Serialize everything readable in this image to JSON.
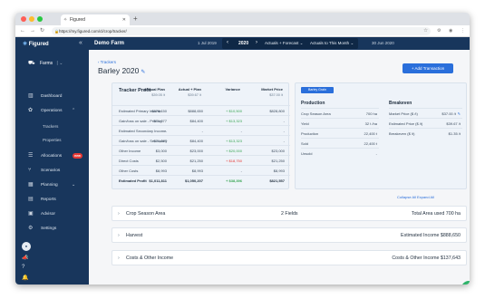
{
  "browser": {
    "tab_title": "Figured",
    "url": "https://my.figured.com/cl/crop/tracker/",
    "colors": {
      "close": "#ff5f57",
      "minimize": "#febc2e",
      "maximize": "#28c840"
    },
    "icons": {
      "back": "arrow-left-icon",
      "forward": "arrow-right-icon",
      "reload": "reload-icon",
      "lock": "lock-icon",
      "star": "star-icon",
      "profile": "profile-icon",
      "menu": "kebab-menu-icon"
    }
  },
  "sidebar": {
    "logo_text": "Figured",
    "farms_label": "Farms",
    "items": [
      {
        "label": "Dashboard",
        "icon": "chart-icon"
      },
      {
        "label": "Operations",
        "icon": "sprout-icon",
        "expanded": true
      },
      {
        "label": "Allocations",
        "icon": "list-icon",
        "badge": "new"
      },
      {
        "label": "Scenarios",
        "icon": "branch-icon"
      },
      {
        "label": "Planning",
        "icon": "grid-icon"
      },
      {
        "label": "Reports",
        "icon": "document-icon"
      },
      {
        "label": "Advisor",
        "icon": "book-icon"
      },
      {
        "label": "Settings",
        "icon": "gear-icon"
      }
    ],
    "sub_items": [
      "Trackers",
      "Properties"
    ],
    "badge_text": "new"
  },
  "topbar": {
    "farm_name": "Demo Farm",
    "date_start": "1 Jul 2019",
    "year": "2020",
    "mode_forecast": "Actuals + Forecast",
    "mode_range": "Actuals to This Month",
    "date_end": "30 Jun 2020"
  },
  "page": {
    "back_link": "Trackers",
    "title": "Barley 2020",
    "add_button": "+ Add Transaction",
    "expand_links": "Collapse All  Expand All"
  },
  "profit": {
    "title": "Tracker Profit",
    "columns": [
      "Annual Plan",
      "Actual + Plan",
      "Variance",
      "Market Price"
    ],
    "column_sub": [
      "$39.05 /t",
      "$39.67 /t",
      "",
      "$37.00 /t"
    ],
    "rows": [
      {
        "label": "Estimated Primary Income",
        "plan": "$878,150",
        "actual": "$888,650",
        "variance": "+ $10,500",
        "market": "$828,800",
        "variance_type": "pos"
      },
      {
        "label": "Gain/loss on sale - Primary",
        "plan": "$71,077",
        "actual": "$84,400",
        "variance": "+ $13,323",
        "market": "-",
        "variance_type": "pos"
      },
      {
        "label": "Estimated Secondary Income",
        "plan": "-",
        "actual": "-",
        "variance": "-",
        "market": "-",
        "variance_type": ""
      },
      {
        "label": "Gain/loss on sale - Secondary",
        "plan": "$71,077",
        "actual": "$84,400",
        "variance": "+ $13,323",
        "market": "-",
        "variance_type": "pos"
      },
      {
        "label": "Other Income",
        "plan": "$3,000",
        "actual": "$23,000",
        "variance": "+ $20,000",
        "market": "$23,000",
        "variance_type": "pos"
      },
      {
        "label": "Direct Costs",
        "plan": "$2,500",
        "actual": "$21,250",
        "variance": "+ $18,750",
        "market": "$21,250",
        "variance_type": "neg"
      },
      {
        "label": "Other Costs",
        "plan": "$8,993",
        "actual": "$8,993",
        "variance": "-",
        "market": "$8,993",
        "variance_type": ""
      },
      {
        "label": "Estimated Profit",
        "plan": "$1,011,811",
        "actual": "$1,050,207",
        "variance": "+ $38,396",
        "market": "$821,557",
        "variance_type": "pos",
        "bold": true
      }
    ]
  },
  "production": {
    "tag": "Barley Grain",
    "title": "Production",
    "rows": [
      {
        "label": "Crop Season Area",
        "value": "700 ha"
      },
      {
        "label": "Yield",
        "value": "32 t /ha"
      },
      {
        "label": "Production",
        "value": "22,400 t"
      },
      {
        "label": "Sold",
        "value": "22,400 t"
      },
      {
        "label": "Unsold",
        "value": "-"
      }
    ]
  },
  "breakeven": {
    "title": "Breakeven",
    "rows": [
      {
        "label": "Market Price ($ /t)",
        "value": "$37.00 /t"
      },
      {
        "label": "Estimated Price ($ /t)",
        "value": "$39.67 /t"
      },
      {
        "label": "Breakeven ($ /t)",
        "value": "$1.35 /t"
      }
    ]
  },
  "sections": [
    {
      "name": "Crop Season Area",
      "middle": "2 Fields",
      "right": "Total Area used   700 ha"
    },
    {
      "name": "Harvest",
      "middle": "",
      "right": "Estimated Income $888,650"
    },
    {
      "name": "Costs & Other Income",
      "middle": "",
      "right": "Costs & Other Income $137,643"
    }
  ]
}
